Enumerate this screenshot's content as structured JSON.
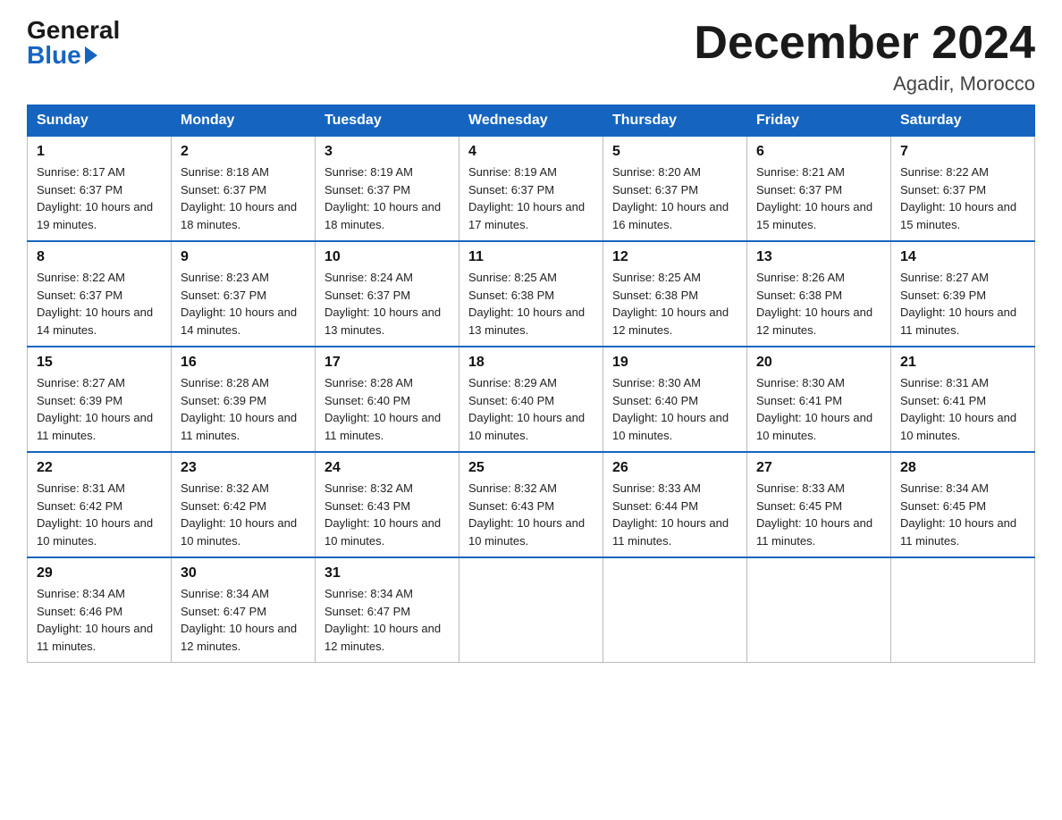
{
  "header": {
    "logo_general": "General",
    "logo_blue": "Blue",
    "month_title": "December 2024",
    "location": "Agadir, Morocco"
  },
  "weekdays": [
    "Sunday",
    "Monday",
    "Tuesday",
    "Wednesday",
    "Thursday",
    "Friday",
    "Saturday"
  ],
  "weeks": [
    [
      {
        "day": "1",
        "sunrise": "8:17 AM",
        "sunset": "6:37 PM",
        "daylight": "10 hours and 19 minutes."
      },
      {
        "day": "2",
        "sunrise": "8:18 AM",
        "sunset": "6:37 PM",
        "daylight": "10 hours and 18 minutes."
      },
      {
        "day": "3",
        "sunrise": "8:19 AM",
        "sunset": "6:37 PM",
        "daylight": "10 hours and 18 minutes."
      },
      {
        "day": "4",
        "sunrise": "8:19 AM",
        "sunset": "6:37 PM",
        "daylight": "10 hours and 17 minutes."
      },
      {
        "day": "5",
        "sunrise": "8:20 AM",
        "sunset": "6:37 PM",
        "daylight": "10 hours and 16 minutes."
      },
      {
        "day": "6",
        "sunrise": "8:21 AM",
        "sunset": "6:37 PM",
        "daylight": "10 hours and 15 minutes."
      },
      {
        "day": "7",
        "sunrise": "8:22 AM",
        "sunset": "6:37 PM",
        "daylight": "10 hours and 15 minutes."
      }
    ],
    [
      {
        "day": "8",
        "sunrise": "8:22 AM",
        "sunset": "6:37 PM",
        "daylight": "10 hours and 14 minutes."
      },
      {
        "day": "9",
        "sunrise": "8:23 AM",
        "sunset": "6:37 PM",
        "daylight": "10 hours and 14 minutes."
      },
      {
        "day": "10",
        "sunrise": "8:24 AM",
        "sunset": "6:37 PM",
        "daylight": "10 hours and 13 minutes."
      },
      {
        "day": "11",
        "sunrise": "8:25 AM",
        "sunset": "6:38 PM",
        "daylight": "10 hours and 13 minutes."
      },
      {
        "day": "12",
        "sunrise": "8:25 AM",
        "sunset": "6:38 PM",
        "daylight": "10 hours and 12 minutes."
      },
      {
        "day": "13",
        "sunrise": "8:26 AM",
        "sunset": "6:38 PM",
        "daylight": "10 hours and 12 minutes."
      },
      {
        "day": "14",
        "sunrise": "8:27 AM",
        "sunset": "6:39 PM",
        "daylight": "10 hours and 11 minutes."
      }
    ],
    [
      {
        "day": "15",
        "sunrise": "8:27 AM",
        "sunset": "6:39 PM",
        "daylight": "10 hours and 11 minutes."
      },
      {
        "day": "16",
        "sunrise": "8:28 AM",
        "sunset": "6:39 PM",
        "daylight": "10 hours and 11 minutes."
      },
      {
        "day": "17",
        "sunrise": "8:28 AM",
        "sunset": "6:40 PM",
        "daylight": "10 hours and 11 minutes."
      },
      {
        "day": "18",
        "sunrise": "8:29 AM",
        "sunset": "6:40 PM",
        "daylight": "10 hours and 10 minutes."
      },
      {
        "day": "19",
        "sunrise": "8:30 AM",
        "sunset": "6:40 PM",
        "daylight": "10 hours and 10 minutes."
      },
      {
        "day": "20",
        "sunrise": "8:30 AM",
        "sunset": "6:41 PM",
        "daylight": "10 hours and 10 minutes."
      },
      {
        "day": "21",
        "sunrise": "8:31 AM",
        "sunset": "6:41 PM",
        "daylight": "10 hours and 10 minutes."
      }
    ],
    [
      {
        "day": "22",
        "sunrise": "8:31 AM",
        "sunset": "6:42 PM",
        "daylight": "10 hours and 10 minutes."
      },
      {
        "day": "23",
        "sunrise": "8:32 AM",
        "sunset": "6:42 PM",
        "daylight": "10 hours and 10 minutes."
      },
      {
        "day": "24",
        "sunrise": "8:32 AM",
        "sunset": "6:43 PM",
        "daylight": "10 hours and 10 minutes."
      },
      {
        "day": "25",
        "sunrise": "8:32 AM",
        "sunset": "6:43 PM",
        "daylight": "10 hours and 10 minutes."
      },
      {
        "day": "26",
        "sunrise": "8:33 AM",
        "sunset": "6:44 PM",
        "daylight": "10 hours and 11 minutes."
      },
      {
        "day": "27",
        "sunrise": "8:33 AM",
        "sunset": "6:45 PM",
        "daylight": "10 hours and 11 minutes."
      },
      {
        "day": "28",
        "sunrise": "8:34 AM",
        "sunset": "6:45 PM",
        "daylight": "10 hours and 11 minutes."
      }
    ],
    [
      {
        "day": "29",
        "sunrise": "8:34 AM",
        "sunset": "6:46 PM",
        "daylight": "10 hours and 11 minutes."
      },
      {
        "day": "30",
        "sunrise": "8:34 AM",
        "sunset": "6:47 PM",
        "daylight": "10 hours and 12 minutes."
      },
      {
        "day": "31",
        "sunrise": "8:34 AM",
        "sunset": "6:47 PM",
        "daylight": "10 hours and 12 minutes."
      },
      null,
      null,
      null,
      null
    ]
  ]
}
